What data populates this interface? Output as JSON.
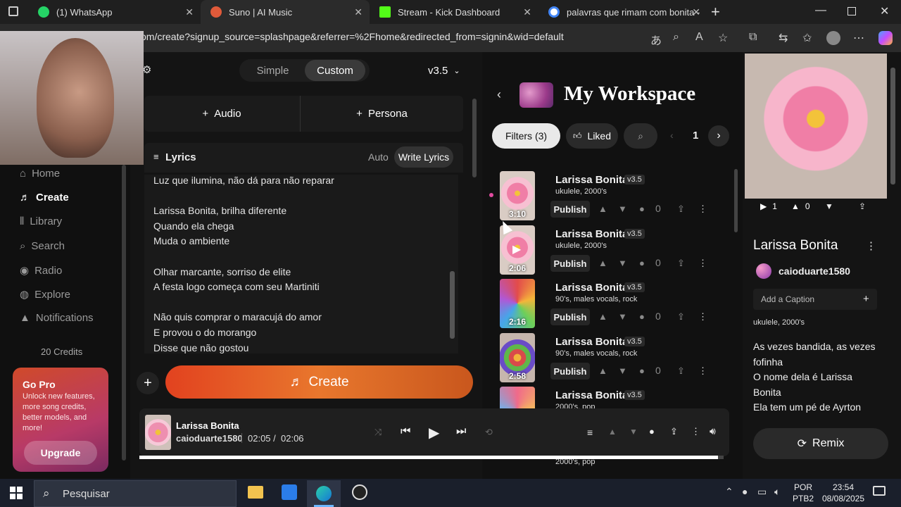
{
  "browser": {
    "tabs": [
      {
        "label": "(1) WhatsApp",
        "color": "#25d366"
      },
      {
        "label": "Suno | AI Music",
        "color": "#e05a3a"
      },
      {
        "label": "Stream - Kick Dashboard",
        "color": "#53fc18"
      },
      {
        "label": "palavras que rimam com bonita -",
        "color": "#4285f4"
      }
    ],
    "url": "om/create?signup_source=splashpage&referrer=%2Fhome&redirected_from=signin&wid=default"
  },
  "sidebar": {
    "items": [
      {
        "label": "Home",
        "icon": "home-icon"
      },
      {
        "label": "Create",
        "icon": "create-icon"
      },
      {
        "label": "Library",
        "icon": "library-icon"
      },
      {
        "label": "Search",
        "icon": "search-icon"
      },
      {
        "label": "Radio",
        "icon": "radio-icon"
      },
      {
        "label": "Explore",
        "icon": "explore-icon"
      },
      {
        "label": "Notifications",
        "icon": "bell-icon"
      }
    ],
    "credits": "20 Credits",
    "gopro": {
      "title": "Go Pro",
      "text": "Unlock new features, more song credits, better models, and more!",
      "button": "Upgrade"
    }
  },
  "create": {
    "mode_simple": "Simple",
    "mode_custom": "Custom",
    "version": "v3.5",
    "audio": "Audio",
    "persona": "Persona",
    "lyrics_label": "Lyrics",
    "auto": "Auto",
    "write_lyrics": "Write Lyrics",
    "lyrics_text": "Luz que ilumina, não dá para não reparar\n\nLarissa Bonita, brilha diferente\nQuando ela chega\nMuda o ambiente\n\nOlhar marcante, sorriso de elite\nA festa logo começa com seu Martiniti\n\nNão quis comprar o maracujá do amor\nE provou o do morango\nDisse que não gostou",
    "create_button": "Create"
  },
  "workspace": {
    "title": "My Workspace",
    "filters": "Filters (3)",
    "liked": "Liked",
    "page": "1",
    "songs": [
      {
        "title": "Larissa Bonita",
        "version": "v3.5",
        "tags": "ukulele, 2000's",
        "duration": "3:10",
        "publish": "Publish",
        "comments": "0"
      },
      {
        "title": "Larissa Bonita",
        "version": "v3.5",
        "tags": "ukulele, 2000's",
        "duration": "2:06",
        "publish": "Publish",
        "comments": "0"
      },
      {
        "title": "Larissa Bonita",
        "version": "v3.5",
        "tags": "90's, males vocals, rock",
        "duration": "2:16",
        "publish": "Publish",
        "comments": "0"
      },
      {
        "title": "Larissa Bonita",
        "version": "v3.5",
        "tags": "90's, males vocals, rock",
        "duration": "2:58",
        "publish": "Publish",
        "comments": "0"
      },
      {
        "title": "Larissa Bonita",
        "version": "v3.5",
        "tags": "2000's, pop",
        "duration": "",
        "publish": "",
        "comments": ""
      }
    ],
    "extra_tags": "2000's, pop"
  },
  "detail": {
    "plays": "1",
    "likes": "0",
    "title": "Larissa Bonita",
    "user": "caioduarte1580",
    "caption_placeholder": "Add a Caption",
    "tags": "ukulele, 2000's",
    "lyrics": "As vezes bandida, as vezes fofinha\nO nome dela é Larissa Bonita\nEla tem um pé de Ayrton",
    "remix": "Remix"
  },
  "player": {
    "title": "Larissa Bonita",
    "user": "caioduarte1580",
    "current": "02:05 /",
    "total": "02:06",
    "progress": 0.99
  },
  "taskbar": {
    "search": "Pesquisar",
    "lang1": "POR",
    "lang2": "PTB2",
    "time": "23:54",
    "date": "08/08/2025"
  }
}
